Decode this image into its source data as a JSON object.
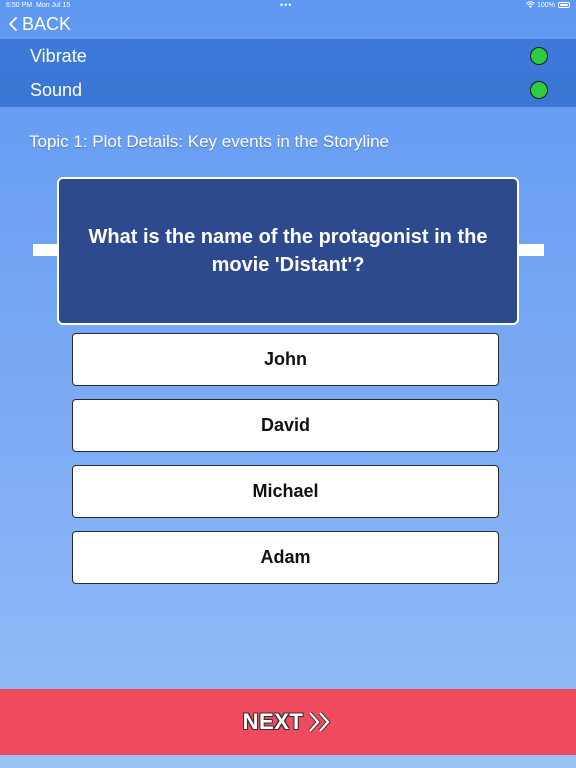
{
  "status_bar": {
    "time": "6:50 PM",
    "date": "Mon Jul 15",
    "battery": "100%"
  },
  "nav": {
    "back_label": "BACK"
  },
  "settings": {
    "vibrate_label": "Vibrate",
    "sound_label": "Sound",
    "toggle_color": "#2ecc40"
  },
  "quiz": {
    "topic": "Topic 1: Plot Details: Key events in the Storyline",
    "question": "What is the name of the protagonist in the movie 'Distant'?",
    "answers": [
      "John",
      "David",
      "Michael",
      "Adam"
    ],
    "next_label": "NEXT"
  },
  "colors": {
    "header_bar": "#3b77d6",
    "question_card": "#2d4a8e",
    "next_button": "#f04a5e"
  }
}
